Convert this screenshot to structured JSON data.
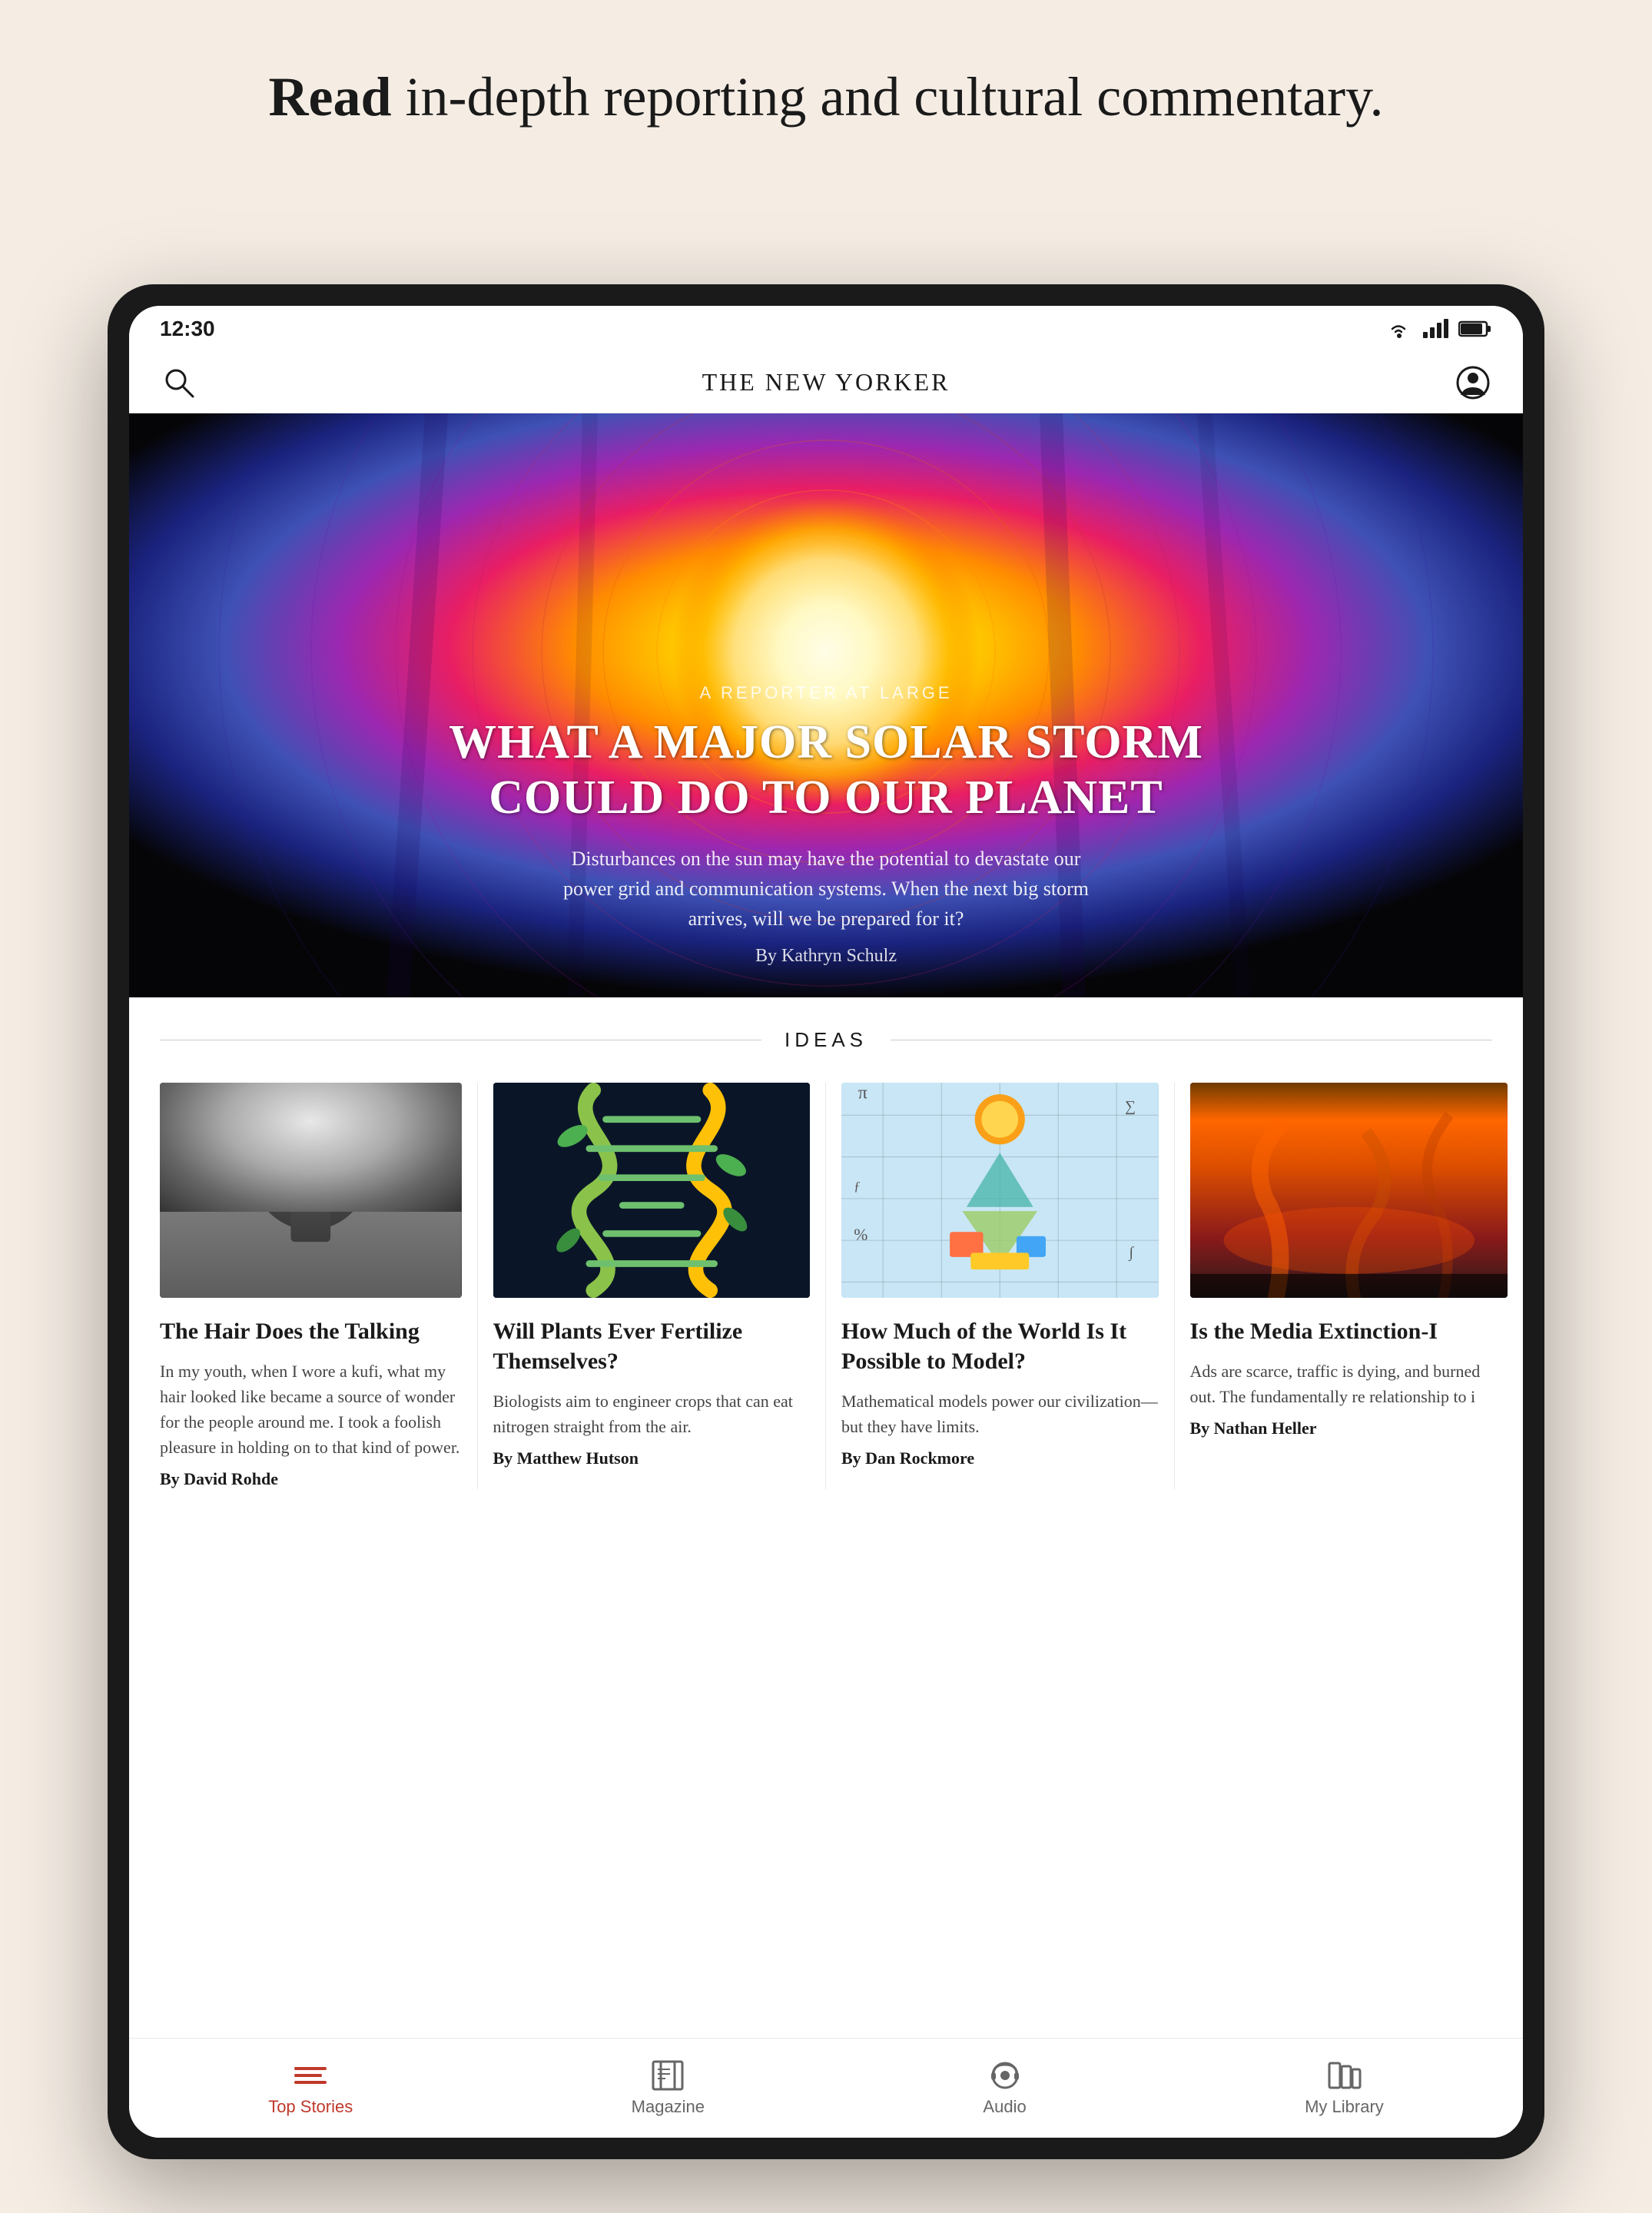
{
  "page": {
    "background_color": "#f5ede4"
  },
  "hero_text": {
    "part1": "Read",
    "part2": " in-depth reporting and cultural commentary."
  },
  "status_bar": {
    "time": "12:30"
  },
  "app_header": {
    "logo": "THE NEW YORKER"
  },
  "hero_article": {
    "section_label": "A REPORTER AT LARGE",
    "title_line1": "WHAT A MAJOR SOLAR STORM",
    "title_line2": "COULD DO TO OUR PLANET",
    "description": "Disturbances on the sun may have the potential to devastate our power grid and communication systems. When the next big storm arrives, will we be prepared for it?",
    "byline": "By Kathryn Schulz"
  },
  "ideas_section": {
    "section_title": "IDEAS",
    "articles": [
      {
        "title": "The Hair Does the Talking",
        "description": "In my youth, when I wore a kufi, what my hair looked like became a source of wonder for the people around me. I took a foolish pleasure in holding on to that kind of power.",
        "byline": "By David Rohde"
      },
      {
        "title": "Will Plants Ever Fertilize Themselves?",
        "description": "Biologists aim to engineer crops that can eat nitrogen straight from the air.",
        "byline": "By Matthew Hutson"
      },
      {
        "title": "How Much of the World Is It Possible to Model?",
        "description": "Mathematical models power our civilization—but they have limits.",
        "byline": "By Dan Rockmore"
      },
      {
        "title": "Is the Media Extinction-I",
        "description": "Ads are scarce, traffic is dying, and burned out. The fundamentally re relationship to i",
        "byline": "By Nathan Heller"
      }
    ]
  },
  "bottom_nav": {
    "items": [
      {
        "label": "Top Stories",
        "active": true
      },
      {
        "label": "Magazine",
        "active": false
      },
      {
        "label": "Audio",
        "active": false
      },
      {
        "label": "My Library",
        "active": false
      }
    ]
  }
}
